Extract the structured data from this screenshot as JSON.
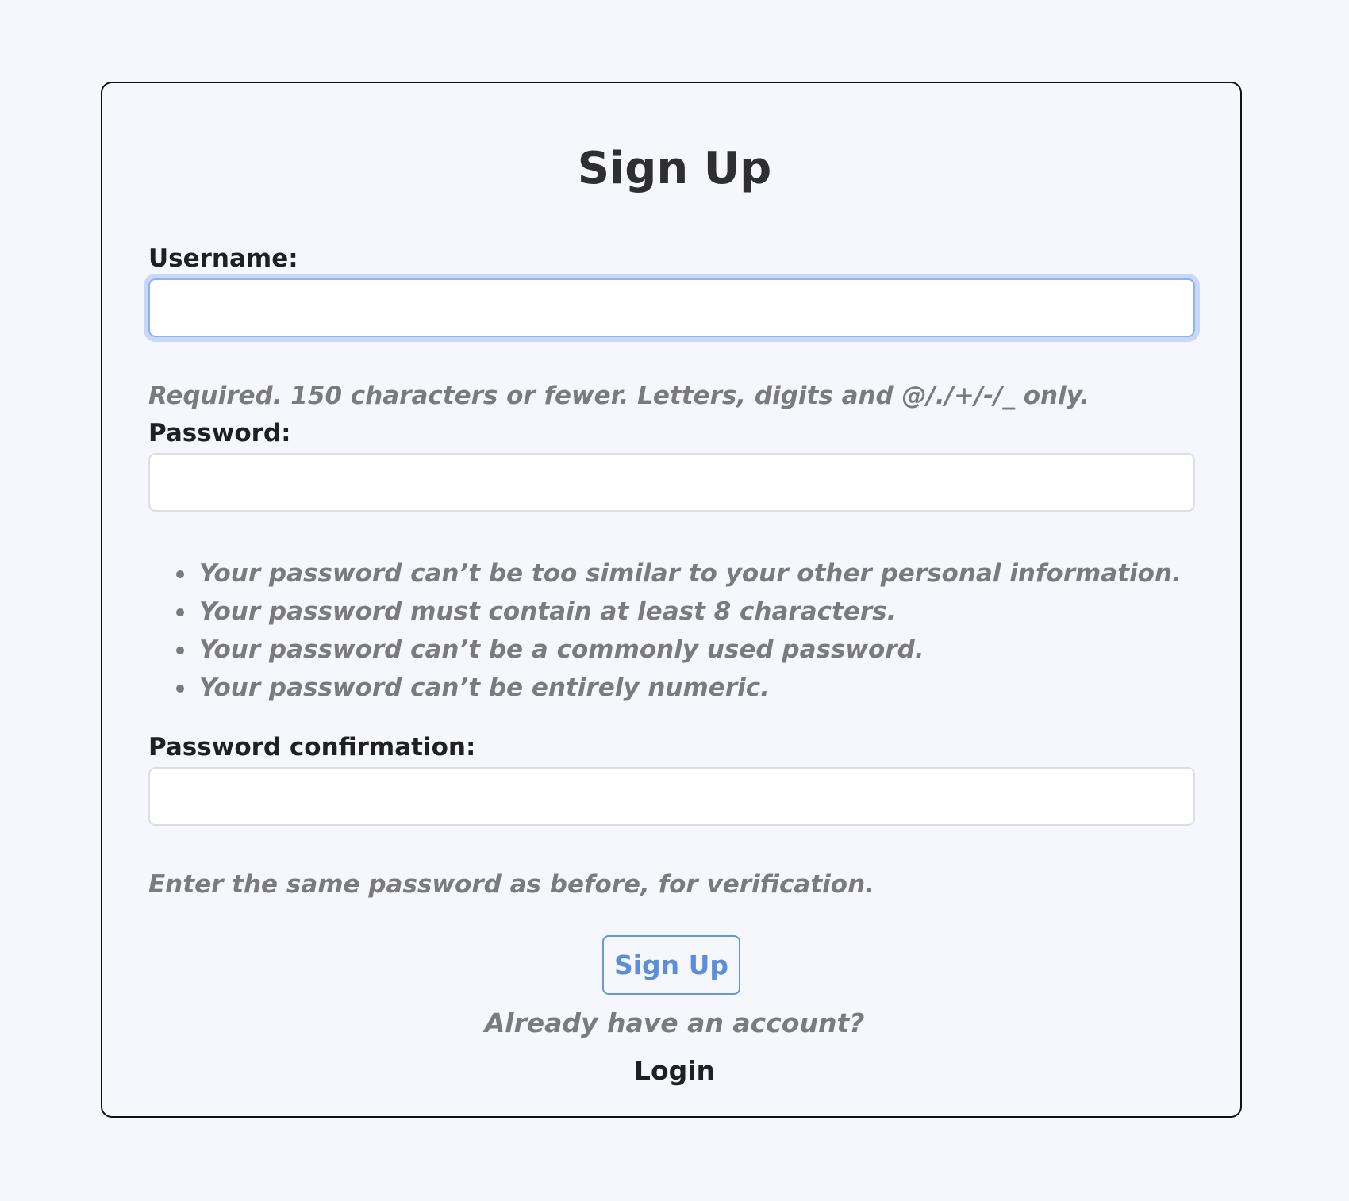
{
  "form": {
    "title": "Sign Up",
    "username": {
      "label": "Username:",
      "value": "",
      "help": "Required. 150 characters or fewer. Letters, digits and @/./+/-/_ only."
    },
    "password": {
      "label": "Password:",
      "value": "",
      "rules": [
        "Your password can’t be too similar to your other personal information.",
        "Your password must contain at least 8 characters.",
        "Your password can’t be a commonly used password.",
        "Your password can’t be entirely numeric."
      ]
    },
    "password_confirmation": {
      "label": "Password confirmation:",
      "value": "",
      "help": "Enter the same password as before, for verification."
    },
    "submit_label": "Sign Up",
    "already_text": "Already have an account?",
    "login_label": "Login"
  },
  "colors": {
    "background": "#f5f7fc",
    "focus_ring": "#c8d9f8",
    "accent": "#5b8ed9",
    "help_text": "#7b7b7f"
  }
}
